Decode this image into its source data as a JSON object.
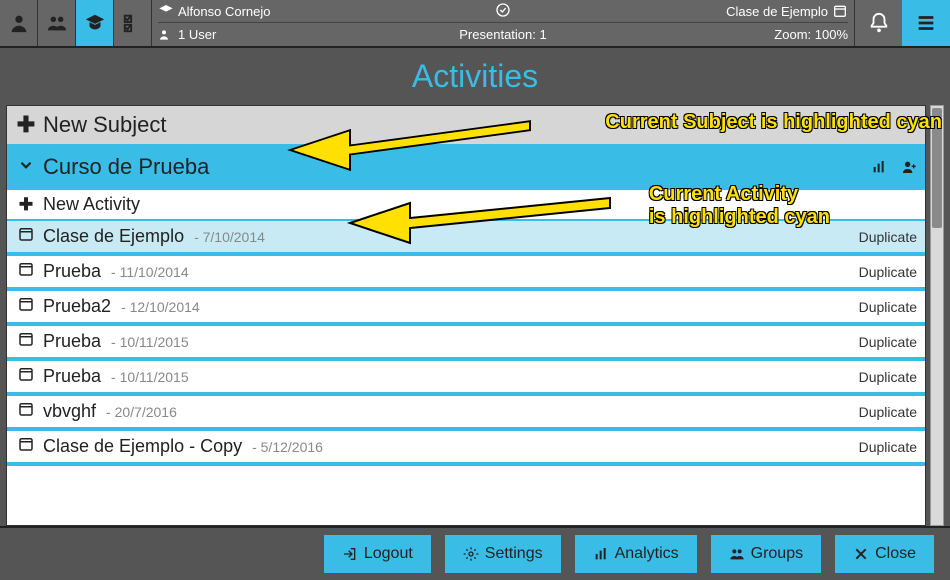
{
  "header": {
    "user_name": "Alfonso Cornejo",
    "class_name": "Clase de Ejemplo",
    "user_count_label": "1 User",
    "presentation_label": "Presentation: 1",
    "zoom_label": "Zoom: 100%"
  },
  "title": "Activities",
  "new_subject_label": "New Subject",
  "subject": {
    "name": "Curso de Prueba"
  },
  "new_activity_label": "New Activity",
  "activities": [
    {
      "name": "Clase de Ejemplo",
      "date": "- 7/10/2014",
      "duplicate": "Duplicate",
      "selected": true
    },
    {
      "name": "Prueba",
      "date": "- 11/10/2014",
      "duplicate": "Duplicate",
      "selected": false
    },
    {
      "name": "Prueba2",
      "date": "- 12/10/2014",
      "duplicate": "Duplicate",
      "selected": false
    },
    {
      "name": "Prueba",
      "date": "- 10/11/2015",
      "duplicate": "Duplicate",
      "selected": false
    },
    {
      "name": "Prueba",
      "date": "- 10/11/2015",
      "duplicate": "Duplicate",
      "selected": false
    },
    {
      "name": "vbvghf",
      "date": "- 20/7/2016",
      "duplicate": "Duplicate",
      "selected": false
    },
    {
      "name": "Clase de Ejemplo - Copy",
      "date": "- 5/12/2016",
      "duplicate": "Duplicate",
      "selected": false
    }
  ],
  "footer": {
    "logout": "Logout",
    "settings": "Settings",
    "analytics": "Analytics",
    "groups": "Groups",
    "close": "Close"
  },
  "annotations": {
    "subject_note": "Current Subject is highlighted cyan",
    "activity_note_l1": "Current Activity",
    "activity_note_l2": "is highlighted cyan"
  }
}
